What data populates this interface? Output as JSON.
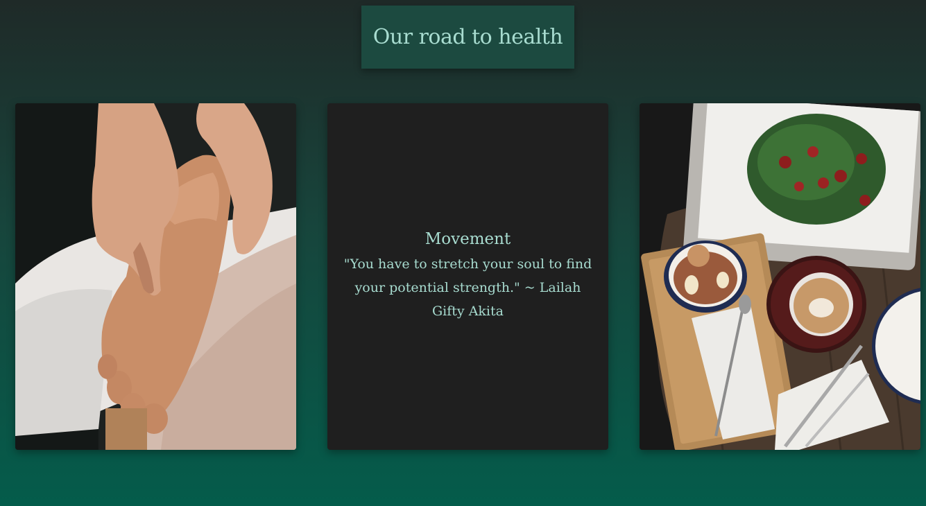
{
  "header": {
    "title": "Our road to health"
  },
  "cards": [
    {
      "kind": "image",
      "image": "foot-massage-photo"
    },
    {
      "kind": "text",
      "heading": "Movement",
      "quote": "\"You have to stretch your soul to find your potential strength.\" ~ Lailah Gifty Akita"
    },
    {
      "kind": "image",
      "image": "healthy-food-table-photo"
    }
  ],
  "colors": {
    "background_top": "#1f2a28",
    "background_bottom": "#045c4b",
    "title_box": "#1c4a40",
    "text": "#a8dcd0",
    "card_dark": "#1f1f1f"
  }
}
